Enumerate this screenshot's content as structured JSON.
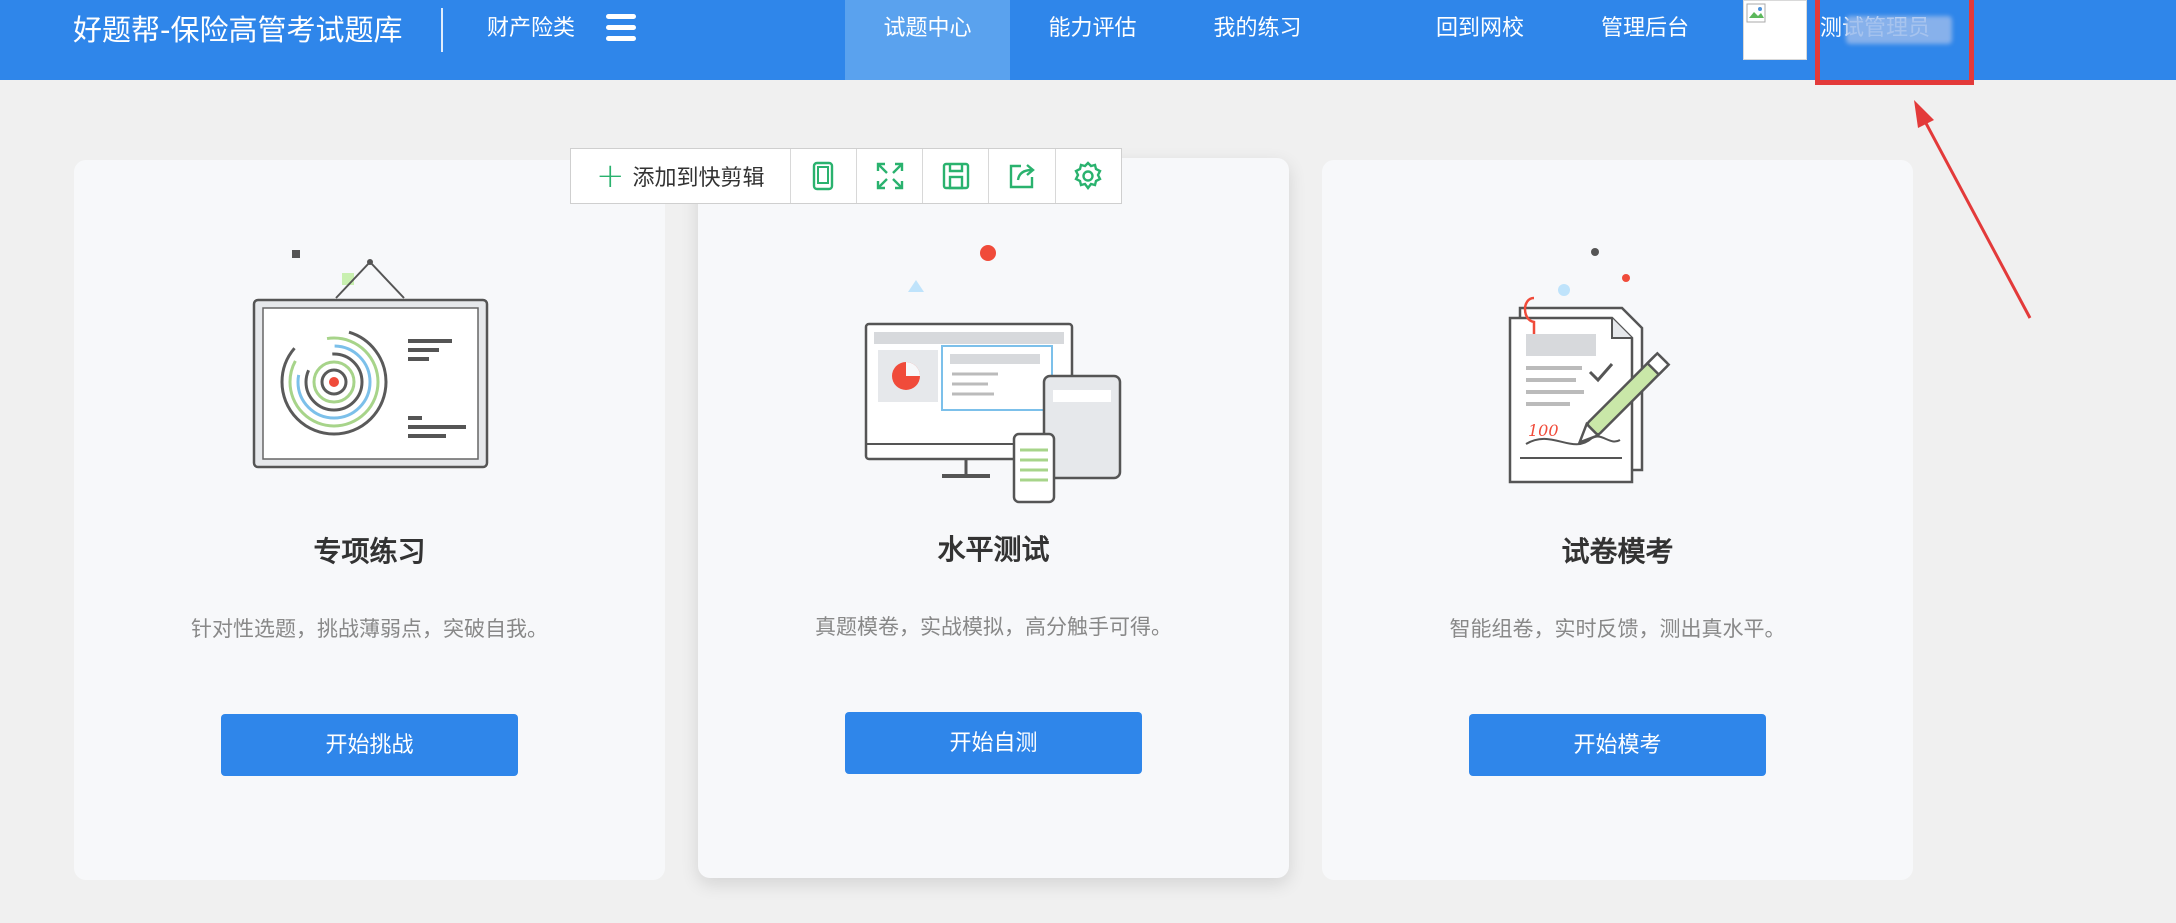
{
  "header": {
    "brand": "好题帮-保险高管考试题库",
    "category": "财产险类",
    "nav": [
      {
        "label": "试题中心",
        "active": true
      },
      {
        "label": "能力评估",
        "active": false
      },
      {
        "label": "我的练习",
        "active": false
      },
      {
        "label": "回到网校",
        "active": false
      },
      {
        "label": "管理后台",
        "active": false
      }
    ],
    "user_name": "测试管理员"
  },
  "toolbar": {
    "add_label": "添加到快剪辑",
    "icons": [
      "tablet-icon",
      "expand-icon",
      "save-icon",
      "share-icon",
      "settings-icon"
    ]
  },
  "cards": [
    {
      "title": "专项练习",
      "description": "针对性选题，挑战薄弱点，突破自我。",
      "button": "开始挑战"
    },
    {
      "title": "水平测试",
      "description": "真题模卷，实战模拟，高分触手可得。",
      "button": "开始自测"
    },
    {
      "title": "试卷模考",
      "description": "智能组卷，实时反馈，测出真水平。",
      "button": "开始模考"
    }
  ],
  "colors": {
    "primary": "#2f86ea",
    "nav_active": "#5aa2ee",
    "page_bg": "#f0f0f0",
    "card_bg": "#f7f8fa",
    "annotation_red": "#e33a3a",
    "toolbar_green": "#2ab26e"
  }
}
